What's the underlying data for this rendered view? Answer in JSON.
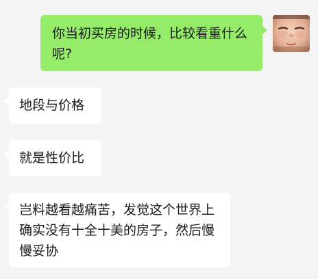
{
  "chat": {
    "messages": [
      {
        "sender": "self",
        "text": "你当初买房的时候，比较看重什么呢?"
      },
      {
        "sender": "other",
        "text": "地段与价格"
      },
      {
        "sender": "other",
        "text": "就是性价比"
      },
      {
        "sender": "other",
        "text": "岂料越看越痛苦，发觉这个世界上确实没有十全十美的房子，然后慢慢妥协"
      }
    ],
    "avatar": {
      "icon": "baby-face-avatar"
    }
  },
  "colors": {
    "background": "#f4f4f4",
    "outgoing_bubble": "#95ec69",
    "incoming_bubble": "#ffffff",
    "text": "#1a1a1a"
  }
}
